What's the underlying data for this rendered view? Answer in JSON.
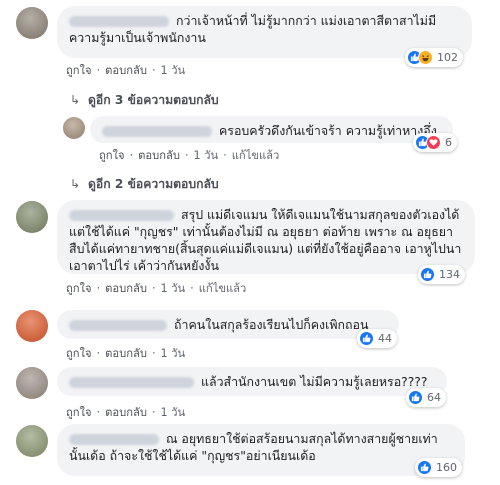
{
  "actions": {
    "like": "ถูกใจ",
    "reply": "ตอบกลับ",
    "edited": "แก้ไขแล้ว",
    "separator": "·"
  },
  "comments": [
    {
      "text": "กว่าเจ้าหน้าที่ ไม่รู้มากกว่า แม่งเอาตาสีตาสาไม่มีความรู้มาเป็นเจ้าพนักงาน",
      "time": "1 วัน",
      "reactions": [
        "like",
        "haha"
      ],
      "reaction_count": "102"
    },
    {
      "text": "ครอบครัวดึงกันเข้าจร้า ความรู้เท่าหางอึ่ง",
      "time": "1 วัน",
      "edited": true,
      "reactions": [
        "like",
        "love"
      ],
      "reaction_count": "6"
    },
    {
      "text": "สรุป แม่ดีเจแมน ให้ดีเจแมนใช้นามสกุลของตัวเองได้ แต่ใช้ได้แค่ \"กุญชร\" เท่านั้นต้องไม่มี ณ อยุธยา ต่อท้าย เพราะ ณ อยุธยาสืบได้แค่ทายาทชาย(สิ้นสุดแค่แม่ดีเจแมน) แต่ที่ยังใช้อยู่คืออาจ เอาหูไปนาเอาตาไปไร่ เค้าว่ากันหยังงั้น",
      "time": "1 วัน",
      "edited": true,
      "reactions": [
        "like"
      ],
      "reaction_count": "134"
    },
    {
      "text": "ถ้าคนในสกุลร้องเรียนไปก็คงเพิกถอน",
      "time": "1 วัน",
      "reactions": [
        "like"
      ],
      "reaction_count": "44"
    },
    {
      "text": "แล้วสำนักงานเขต ไม่มีความรู้เลยหรอ????",
      "time": "1 วัน",
      "reactions": [
        "like"
      ],
      "reaction_count": "64"
    },
    {
      "text": "ณ อยุทธยาใช้ต่อสร้อยนามสกุลได้ทางสายผู้ชายเท่านั้นเด้อ ถ้าจะใช้ใช้ได้แค่ \"กุญชร\"อย่าเนียนเด้อ",
      "time": "",
      "reactions": [
        "like"
      ],
      "reaction_count": "160"
    }
  ],
  "more_replies": [
    {
      "label": "ดูอีก 3 ข้อความตอบกลับ"
    },
    {
      "label": "ดูอีก 2 ข้อความตอบกลับ"
    }
  ],
  "icons": {
    "like": "thumbs-up-icon",
    "haha": "laughing-face-icon",
    "love": "heart-icon",
    "arrow": "reply-arrow-icon"
  },
  "colors": {
    "like": "#1877f2",
    "haha": "#f7b125",
    "love": "#f33e58",
    "bubble": "#f2f3f5"
  }
}
